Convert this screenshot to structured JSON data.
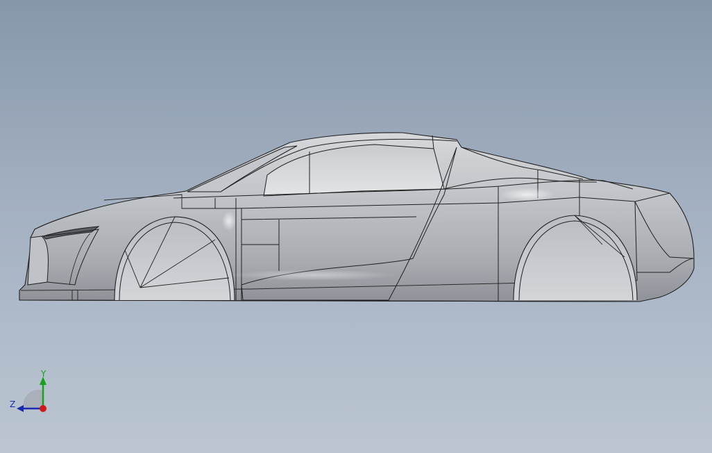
{
  "viewport": {
    "background_top": "#8797ab",
    "background_bottom": "#bcc6d2"
  },
  "model": {
    "name": "car-body-side-view",
    "body_color": "#b9bcc0",
    "edge_color": "#1f1f1f"
  },
  "triad": {
    "y_label": "Y",
    "z_label": "Z",
    "y_color": "#1aa01a",
    "z_color": "#1a2ab0",
    "origin_color": "#d01818"
  }
}
